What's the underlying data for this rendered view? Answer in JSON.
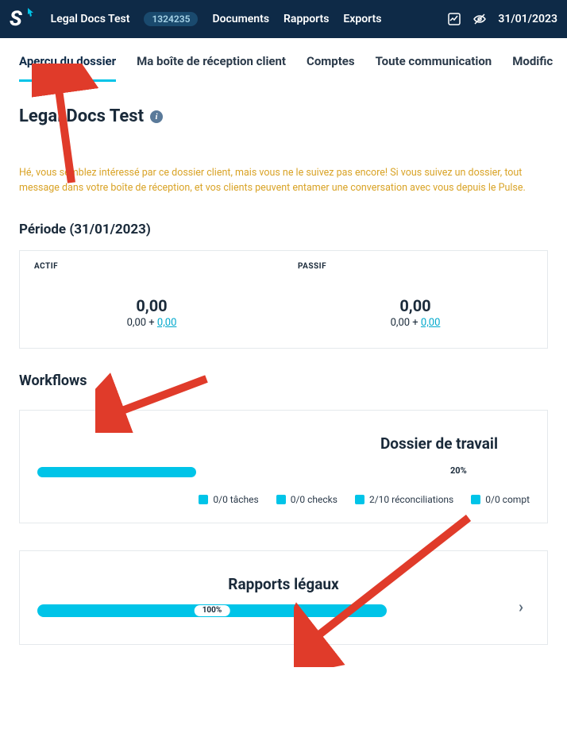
{
  "nav": {
    "client": "Legal Docs Test",
    "badge": "1324235",
    "documents": "Documents",
    "rapports": "Rapports",
    "exports": "Exports",
    "date": "31/01/2023"
  },
  "tabs": [
    {
      "label": "Aperçu du dossier",
      "active": true
    },
    {
      "label": "Ma boîte de réception client",
      "active": false
    },
    {
      "label": "Comptes",
      "active": false
    },
    {
      "label": "Toute communication",
      "active": false
    },
    {
      "label": "Modific",
      "active": false
    }
  ],
  "page_title": "Legal Docs Test",
  "notice": "Hé, vous semblez intéressé par ce dossier client, mais vous ne le suivez pas encore! Si vous suivez un dossier, tout message dans votre boîte de réception, et vos clients peuvent entamer une conversation avec vous depuis le Pulse.",
  "period_label": "Période (31/01/2023)",
  "balance": {
    "actif_label": "ACTIF",
    "actif_val": "0,00",
    "actif_sub_a": "0,00 + ",
    "actif_sub_b": "0,00",
    "passif_label": "PASSIF",
    "passif_val": "0,00",
    "passif_sub_a": "0,00 + ",
    "passif_sub_b": "0,00"
  },
  "workflows_heading": "Workflows",
  "wf": {
    "title": "Dossier de travail",
    "pct": "20%",
    "legend": [
      "0/0 tâches",
      "0/0 checks",
      "2/10 réconciliations",
      "0/0 compt"
    ]
  },
  "rp": {
    "title": "Rapports légaux",
    "pct": "100%"
  }
}
